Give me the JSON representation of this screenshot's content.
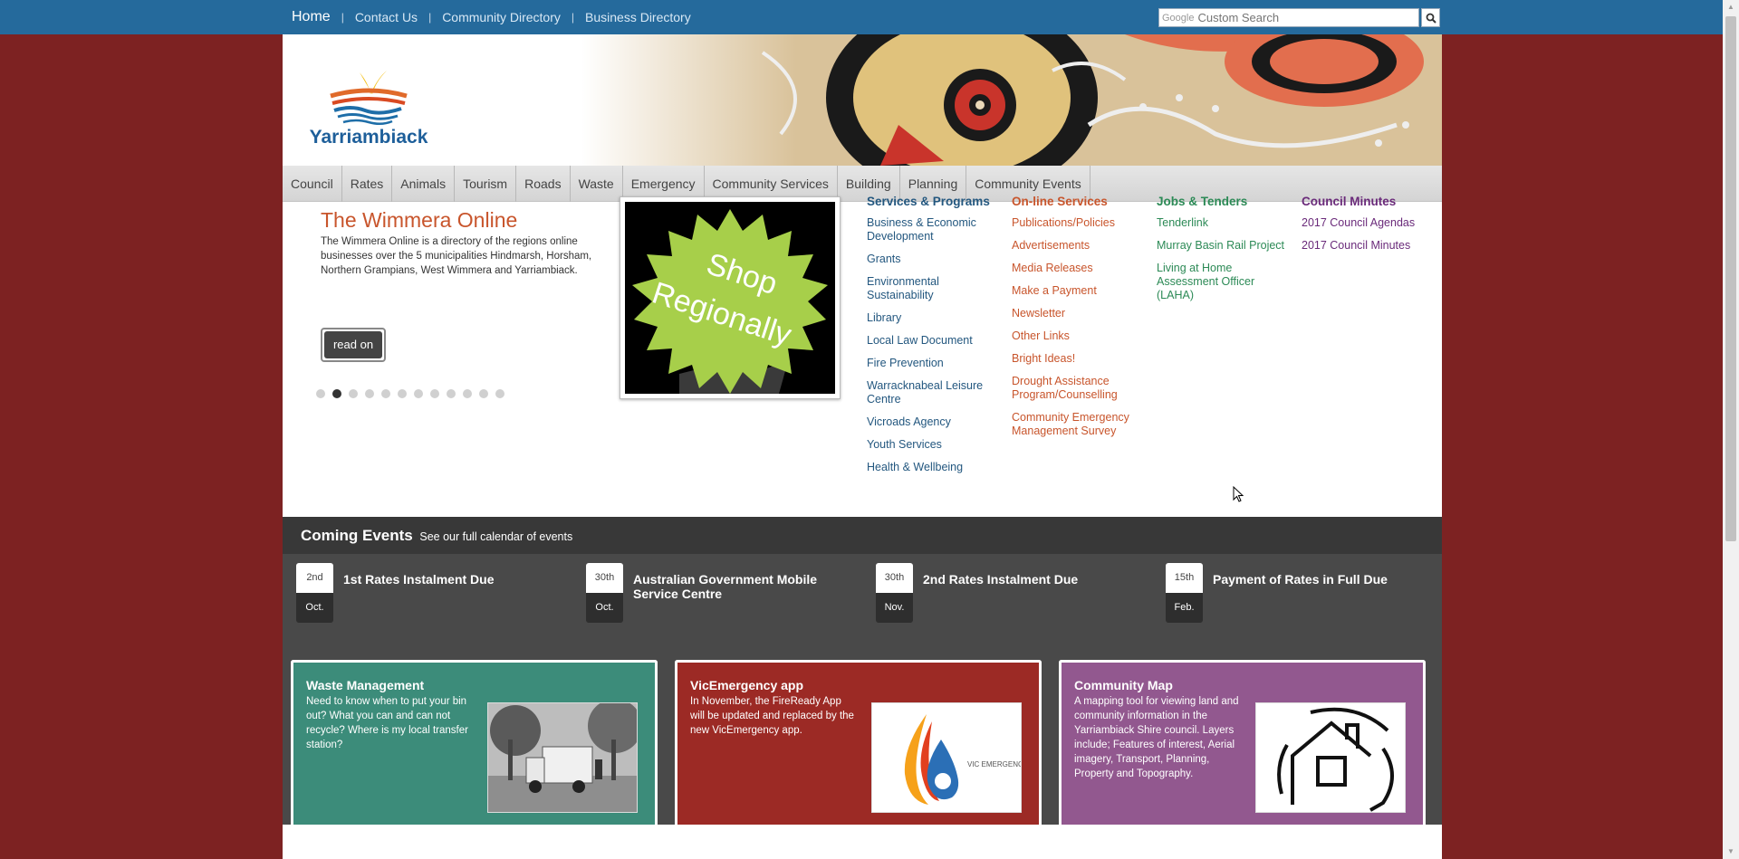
{
  "topnav": {
    "home": "Home",
    "contact": "Contact Us",
    "community_directory": "Community Directory",
    "business_directory": "Business Directory"
  },
  "search": {
    "google_label": "Google",
    "placeholder": "Custom Search"
  },
  "logo": {
    "text": "Yarriambiack"
  },
  "mainnav": [
    "Council",
    "Rates",
    "Animals",
    "Tourism",
    "Roads",
    "Waste",
    "Emergency",
    "Community Services",
    "Building",
    "Planning",
    "Community Events"
  ],
  "slider": {
    "title": "The Wimmera Online",
    "text": "The Wimmera Online is a directory of the regions online businesses over the 5 municipalities Hindmarsh, Horsham, Northern Grampians, West Wimmera and Yarriambiack.",
    "read_on": "read on",
    "dot_count": 12,
    "active_dot": 2
  },
  "promo": {
    "line1": "Shop",
    "line2": "Regionally"
  },
  "columns": {
    "services": {
      "heading": "Services & Programs",
      "links": [
        "Business & Economic Development",
        "Grants",
        "Environmental Sustainability",
        "Library",
        "Local Law Document",
        "Fire Prevention",
        "Warracknabeal Leisure Centre",
        "Vicroads Agency",
        "Youth Services",
        "Health & Wellbeing"
      ]
    },
    "online": {
      "heading": "On-line Services",
      "links": [
        "Publications/Policies",
        "Advertisements",
        "Media Releases",
        "Make a Payment",
        "Newsletter",
        "Other Links",
        "Bright Ideas!",
        "Drought Assistance Program/Counselling",
        "Community Emergency Management Survey"
      ]
    },
    "jobs": {
      "heading": "Jobs & Tenders",
      "links": [
        "Tenderlink",
        "Murray Basin Rail Project",
        "Living at Home Assessment Officer (LAHA)"
      ]
    },
    "minutes": {
      "heading": "Council Minutes",
      "links": [
        "2017 Council Agendas",
        "2017 Council Minutes"
      ]
    }
  },
  "events": {
    "heading": "Coming Events",
    "calendar_link": "See our full calendar of events",
    "items": [
      {
        "day": "2nd",
        "month": "Oct.",
        "title": "1st Rates Instalment Due"
      },
      {
        "day": "30th",
        "month": "Oct.",
        "title": "Australian Government Mobile Service Centre"
      },
      {
        "day": "30th",
        "month": "Nov.",
        "title": "2nd Rates Instalment Due"
      },
      {
        "day": "15th",
        "month": "Feb.",
        "title": "Payment of Rates in Full Due"
      }
    ]
  },
  "cards": [
    {
      "title": "Waste Management",
      "text": "Need to know when to put your bin out? What you can and can not recycle? Where is my local transfer station?"
    },
    {
      "title": "VicEmergency app",
      "text": "In November, the FireReady App will be updated and replaced by the new VicEmergency app.",
      "logo_text": "VIC EMERGENCY"
    },
    {
      "title": "Community Map",
      "text": "A mapping tool for viewing land and community information in the Yarriambiack Shire council. Layers include; Features of interest, Aerial imagery, Transport, Planning, Property and Topography."
    }
  ],
  "colors": {
    "page_bg": "#7d2222",
    "topbar": "#256a9c",
    "services": "#23577f",
    "online": "#c8552c",
    "jobs": "#2c8a56",
    "minutes": "#6a2a7a",
    "card_green": "#3c8c7a",
    "card_red": "#9c2a25",
    "card_purple": "#92588f"
  }
}
